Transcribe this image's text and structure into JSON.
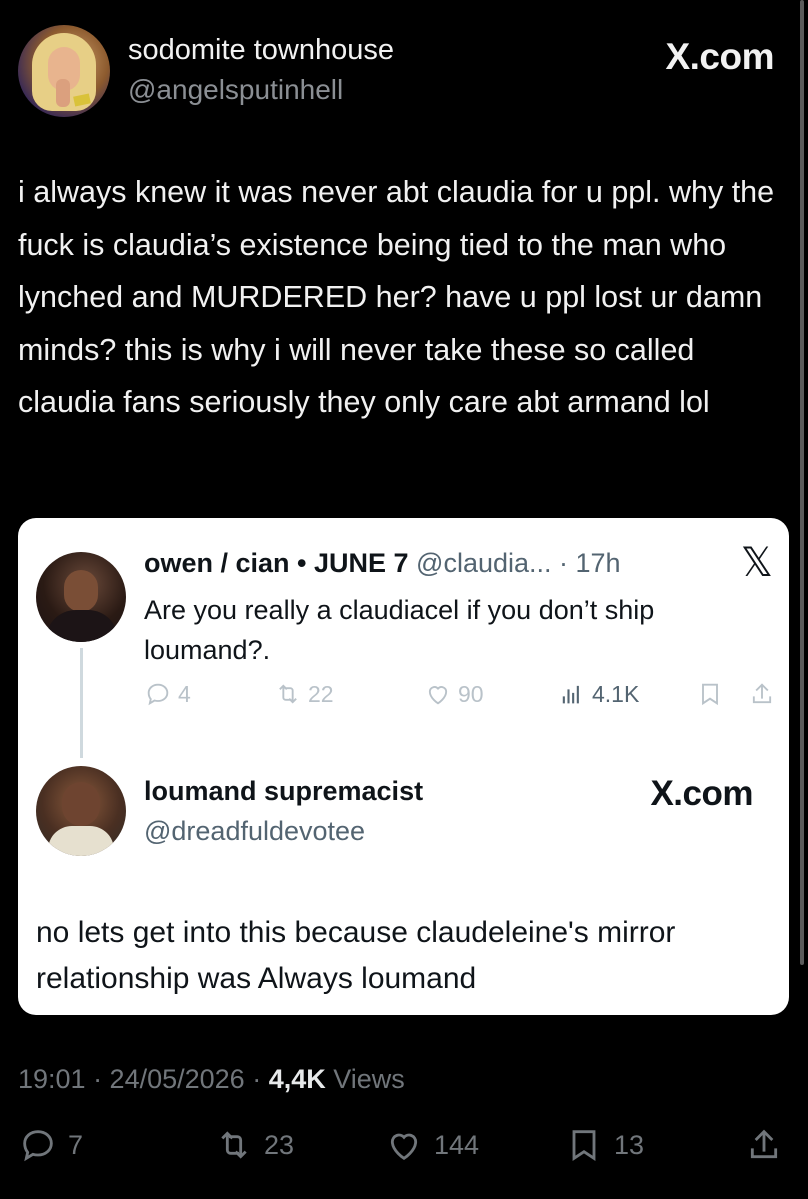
{
  "post": {
    "display_name": "sodomite townhouse",
    "handle": "@angelsputinhell",
    "site_label": "X.com",
    "text": "i always knew it was never abt claudia for u ppl. why the fuck is claudia’s existence being tied to the man who lynched and MURDERED her? have u ppl lost ur damn minds? this is why i will never take these so called claudia fans seriously they only care abt armand lol",
    "timestamp": "19:01 · 24/05/2026 · ",
    "views_count": "4,4K",
    "views_label": " Views",
    "stats": {
      "replies": "7",
      "reposts": "23",
      "likes": "144",
      "bookmarks": "13"
    }
  },
  "quoted": {
    "name": "owen / cian • JUNE 7",
    "meta": " @claudia... · 17h",
    "x_icon": "𝕏",
    "text": "Are you really a claudiacel if you don’t ship loumand?.",
    "stats": {
      "replies": "4",
      "reposts": "22",
      "likes": "90",
      "views": "4.1K"
    }
  },
  "reply": {
    "name": "loumand supremacist",
    "handle": "@dreadfuldevotee",
    "site_label": "X.com",
    "text": "no lets get into this because claudeleine's mirror relationship was Always loumand"
  }
}
